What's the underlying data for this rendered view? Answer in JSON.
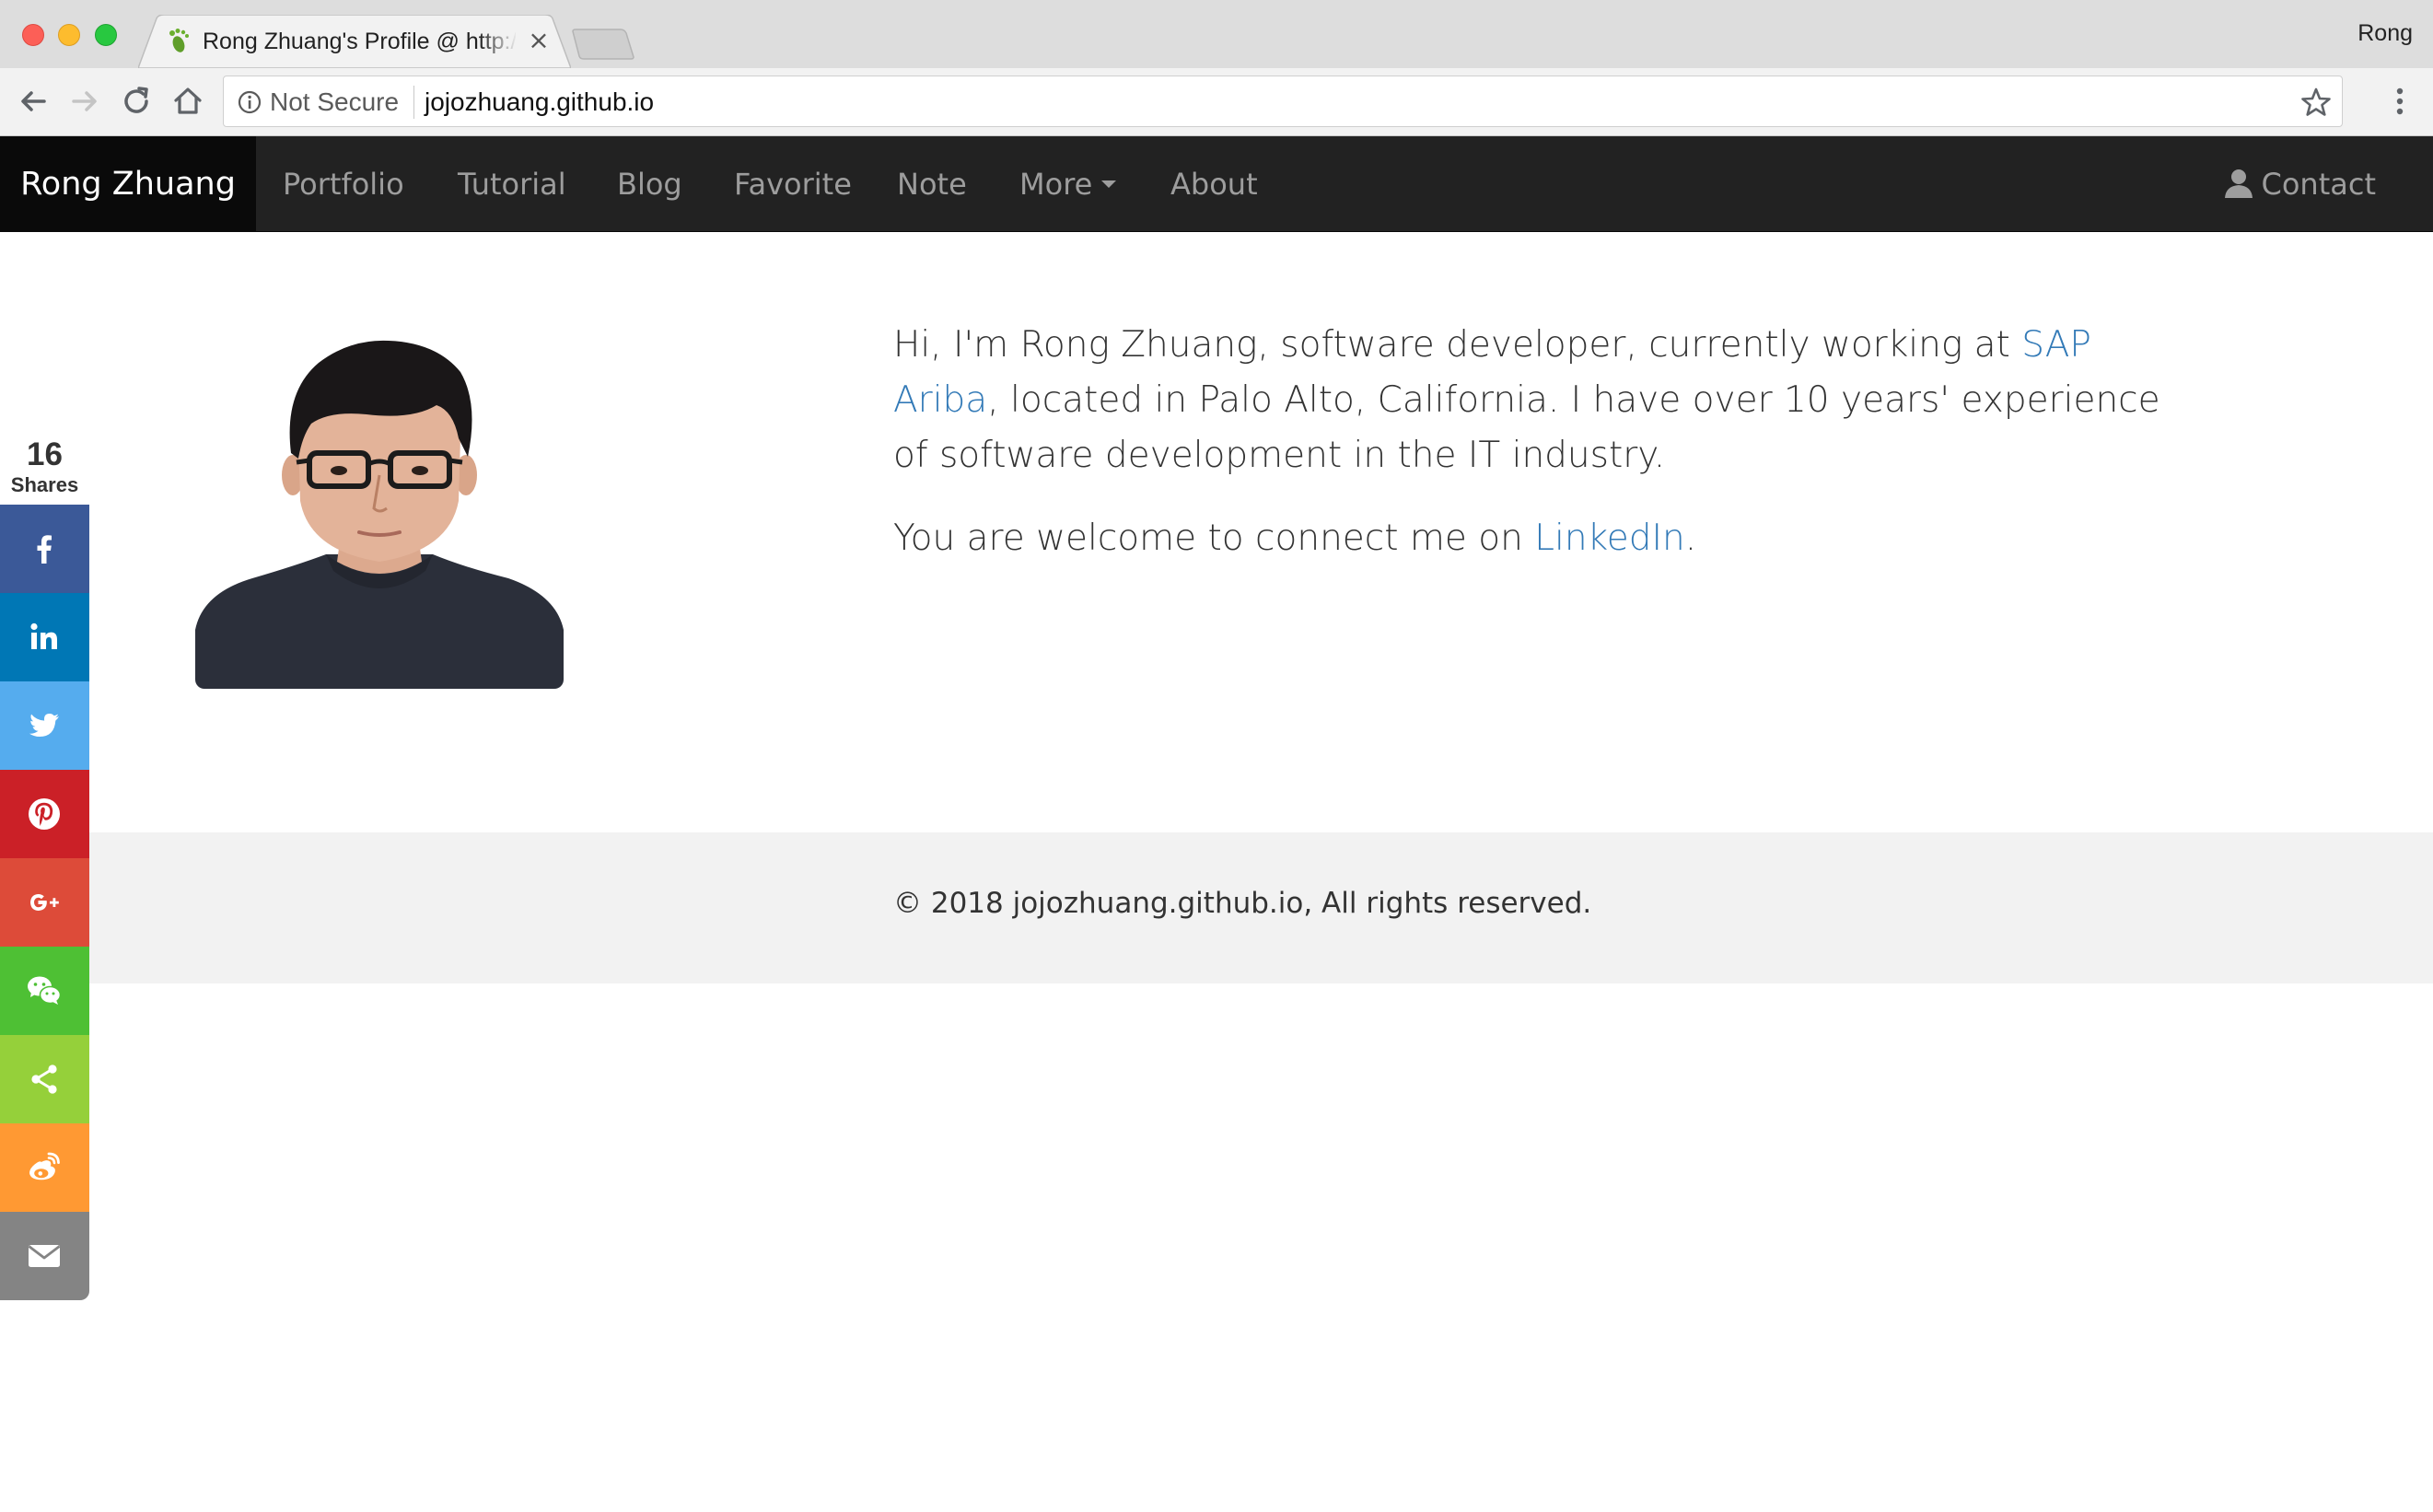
{
  "browser": {
    "tab_title": "Rong Zhuang's Profile @ http://jojozhuang.github.io",
    "tab_close": "×",
    "profile_name": "Rong",
    "security_label": "Not Secure",
    "url": "jojozhuang.github.io"
  },
  "navbar": {
    "brand": "Rong Zhuang",
    "items": [
      {
        "label": "Portfolio"
      },
      {
        "label": "Tutorial"
      },
      {
        "label": "Blog"
      },
      {
        "label": "Favorite"
      },
      {
        "label": "Note"
      },
      {
        "label": "More"
      },
      {
        "label": "About"
      }
    ],
    "contact": "Contact"
  },
  "intro": {
    "line1_pre": "Hi, I'm Rong Zhuang, software developer, currently working at ",
    "employer_link": "SAP Ariba",
    "line1_post": ", located in Palo Alto, California. I have over 10 years' experience of software development in the IT industry.",
    "line2_pre": "You are welcome to connect me on ",
    "linkedin_link": "LinkedIn",
    "line2_post": "."
  },
  "footer": {
    "copyright": "© 2018 jojozhuang.github.io, All rights reserved."
  },
  "share": {
    "count": "16",
    "label": "Shares",
    "buttons": [
      {
        "icon": "facebook-icon",
        "color": "#3b5998"
      },
      {
        "icon": "linkedin-icon",
        "color": "#0077b5"
      },
      {
        "icon": "twitter-icon",
        "color": "#55acee"
      },
      {
        "icon": "pinterest-icon",
        "color": "#cb2027"
      },
      {
        "icon": "google-plus-icon",
        "color": "#dd4b39"
      },
      {
        "icon": "wechat-icon",
        "color": "#4ec034"
      },
      {
        "icon": "share-icon",
        "color": "#95d03a"
      },
      {
        "icon": "weibo-icon",
        "color": "#ff9933"
      },
      {
        "icon": "email-icon",
        "color": "#848484"
      }
    ]
  },
  "colors": {
    "navbar_bg": "#222222",
    "brand_bg": "#0a0a0a",
    "link": "#337ab7",
    "footer_bg": "#f2f2f2"
  }
}
